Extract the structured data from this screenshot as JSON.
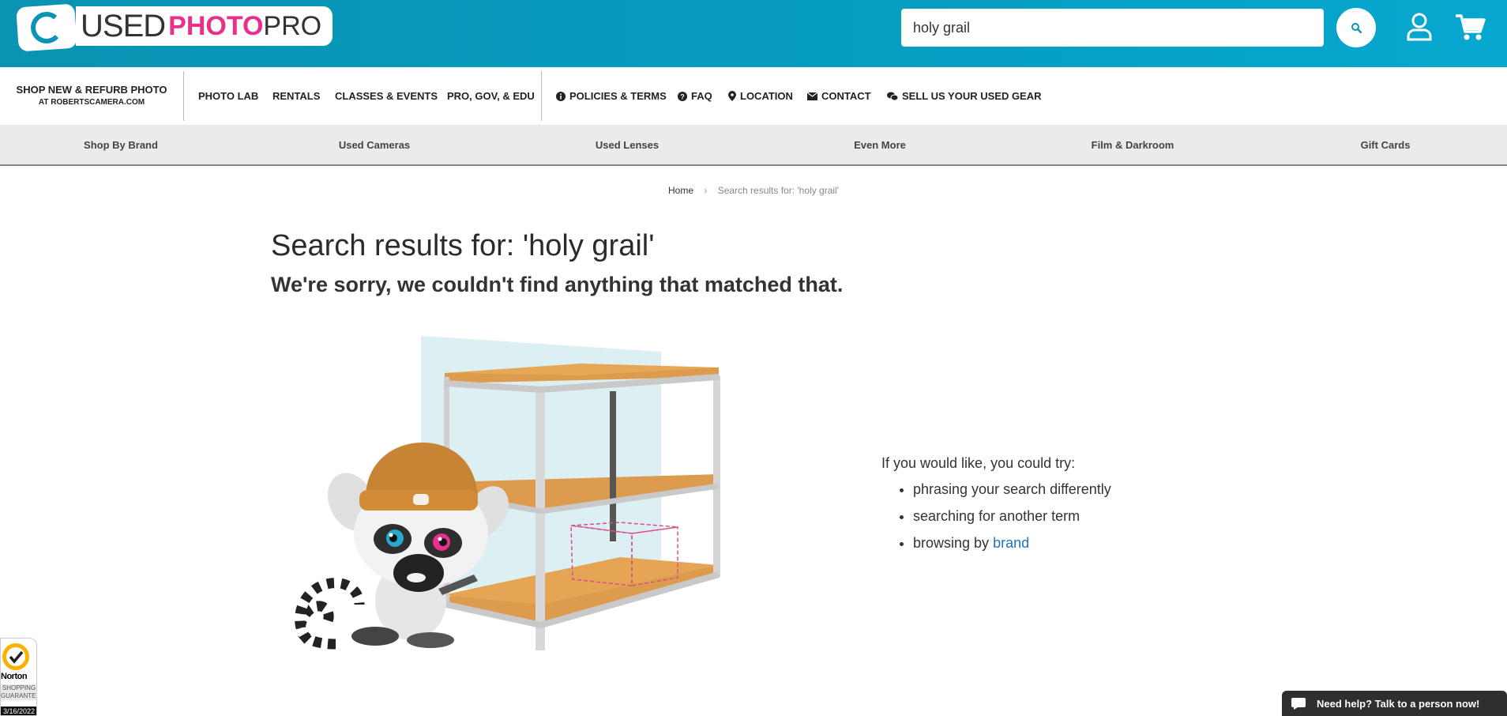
{
  "header": {
    "logo": {
      "used": "USED",
      "photo": "PHOTO",
      "pro": "PRO"
    },
    "search": {
      "value": "holy grail",
      "placeholder": ""
    },
    "icons": {
      "search": "search-icon",
      "account": "user-icon",
      "cart": "cart-icon"
    }
  },
  "subnav": {
    "shop_new_line1": "SHOP NEW & REFURB PHOTO",
    "shop_new_line2": "AT ROBERTSCAMERA.COM",
    "links": [
      {
        "label": "PHOTO LAB"
      },
      {
        "label": "RENTALS"
      },
      {
        "label": "CLASSES & EVENTS"
      },
      {
        "label": "PRO, GOV, & EDU"
      }
    ],
    "info_links": [
      {
        "label": "POLICIES & TERMS",
        "icon": "info-icon"
      },
      {
        "label": "FAQ",
        "icon": "question-icon"
      },
      {
        "label": "LOCATION",
        "icon": "map-pin-icon"
      },
      {
        "label": "CONTACT",
        "icon": "envelope-icon"
      },
      {
        "label": "SELL US YOUR USED GEAR",
        "icon": "chat-icon"
      }
    ]
  },
  "categories": [
    {
      "label": "Shop By Brand"
    },
    {
      "label": "Used Cameras"
    },
    {
      "label": "Used Lenses"
    },
    {
      "label": "Even More"
    },
    {
      "label": "Film & Darkroom"
    },
    {
      "label": "Gift Cards"
    }
  ],
  "breadcrumb": {
    "home": "Home",
    "separator": "›",
    "current": "Search results for: 'holy grail'"
  },
  "main": {
    "title": "Search results for: 'holy grail'",
    "sorry": "We're sorry, we couldn't find anything that matched that.",
    "try_intro": "If you would like, you could try:",
    "suggestions": [
      {
        "text": "phrasing your search differently"
      },
      {
        "text": "searching for another term"
      },
      {
        "text": "browsing by ",
        "link": "brand"
      }
    ]
  },
  "norton": {
    "name": "Norton",
    "line1": "SHOPPING",
    "line2": "GUARANTEE",
    "date": "3/16/2022"
  },
  "help_widget": {
    "label": "Need help? Talk to a person now!"
  },
  "colors": {
    "header_bg": "#079ec2",
    "brand_pink": "#e8308a",
    "link": "#1f75b8",
    "shelf": "#dd9b4d"
  }
}
